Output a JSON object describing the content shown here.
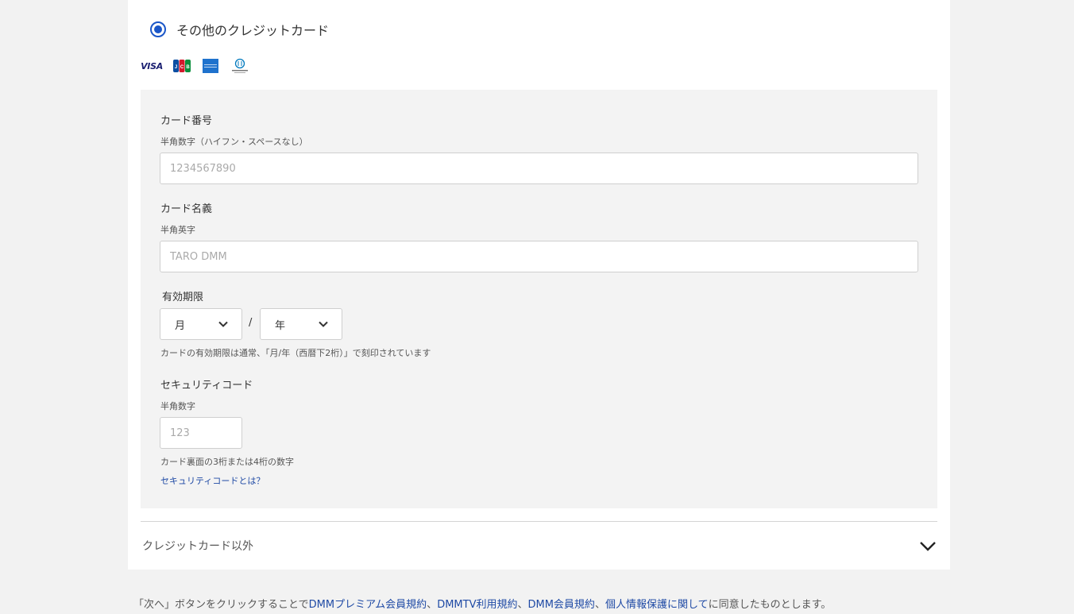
{
  "payment": {
    "option_label": "その他のクレジットカード",
    "brands": [
      "VISA",
      "JCB",
      "AMEX",
      "Diners Club"
    ]
  },
  "form": {
    "card_number": {
      "label": "カード番号",
      "sublabel": "半角数字（ハイフン・スペースなし）",
      "placeholder": "1234567890"
    },
    "card_name": {
      "label": "カード名義",
      "sublabel": "半角英字",
      "placeholder": "TARO DMM"
    },
    "expiry": {
      "label": "有効期限",
      "month": "月",
      "separator": "/",
      "year": "年",
      "hint": "カードの有効期限は通常、「月/年（西暦下2桁）」で刻印されています"
    },
    "security": {
      "label": "セキュリティコード",
      "sublabel": "半角数字",
      "placeholder": "123",
      "hint": "カード裏面の3桁または4桁の数字",
      "link": "セキュリティコードとは？"
    }
  },
  "other_methods": {
    "label": "クレジットカード以外"
  },
  "footer": {
    "prefix": "「次へ」ボタンをクリックすることで",
    "link1": "DMMプレミアム会員規約",
    "sep1": "、",
    "link2": "DMMTV利用規約",
    "sep2": "、",
    "link3": "DMM会員規約",
    "sep3": "、",
    "link4": "個人情報保護に関して",
    "suffix": "に同意したものとします。"
  },
  "colors": {
    "accent": "#1a56c8",
    "link": "#1f4aa5",
    "panel": "#f3f3f3",
    "background": "#f2f2f2"
  }
}
